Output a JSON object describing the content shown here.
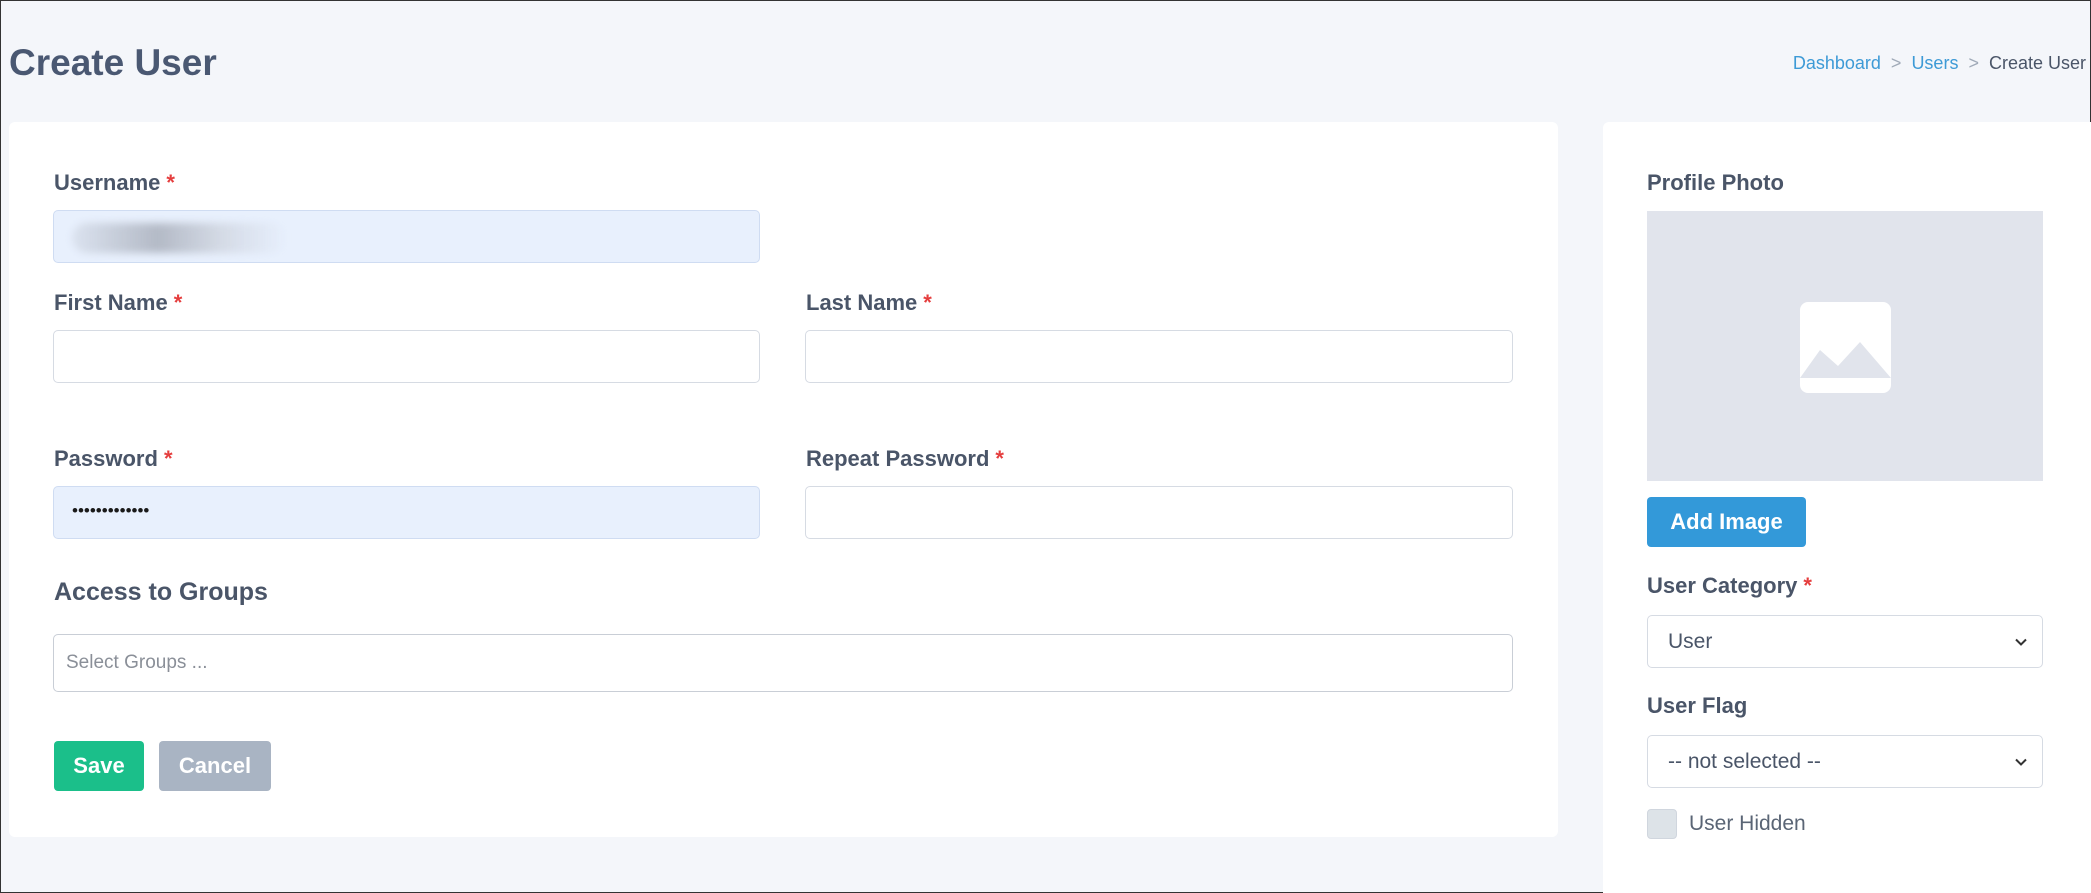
{
  "page": {
    "title": "Create User",
    "breadcrumb": [
      "Dashboard",
      "Users",
      "Create User"
    ],
    "breadcrumb_separator": ">"
  },
  "form": {
    "username_label": "Username",
    "first_name_label": "First Name",
    "last_name_label": "Last Name",
    "password_label": "Password",
    "password_value": "•••••••••••••",
    "repeat_password_label": "Repeat Password",
    "required_marker": "*",
    "groups_title": "Access to Groups",
    "groups_placeholder": "Select Groups ...",
    "save_label": "Save",
    "cancel_label": "Cancel"
  },
  "sidebar": {
    "photo_label": "Profile Photo",
    "add_image_label": "Add Image",
    "category_label": "User Category",
    "category_value": "User",
    "flag_label": "User Flag",
    "flag_value": "-- not selected --",
    "hidden_label": "User Hidden"
  },
  "colors": {
    "accent_blue": "#3399d9",
    "save_green": "#1bbf8a",
    "cancel_gray": "#a9b4c3",
    "required_red": "#e53e3e",
    "autofill_bg": "#e8f0fd"
  }
}
